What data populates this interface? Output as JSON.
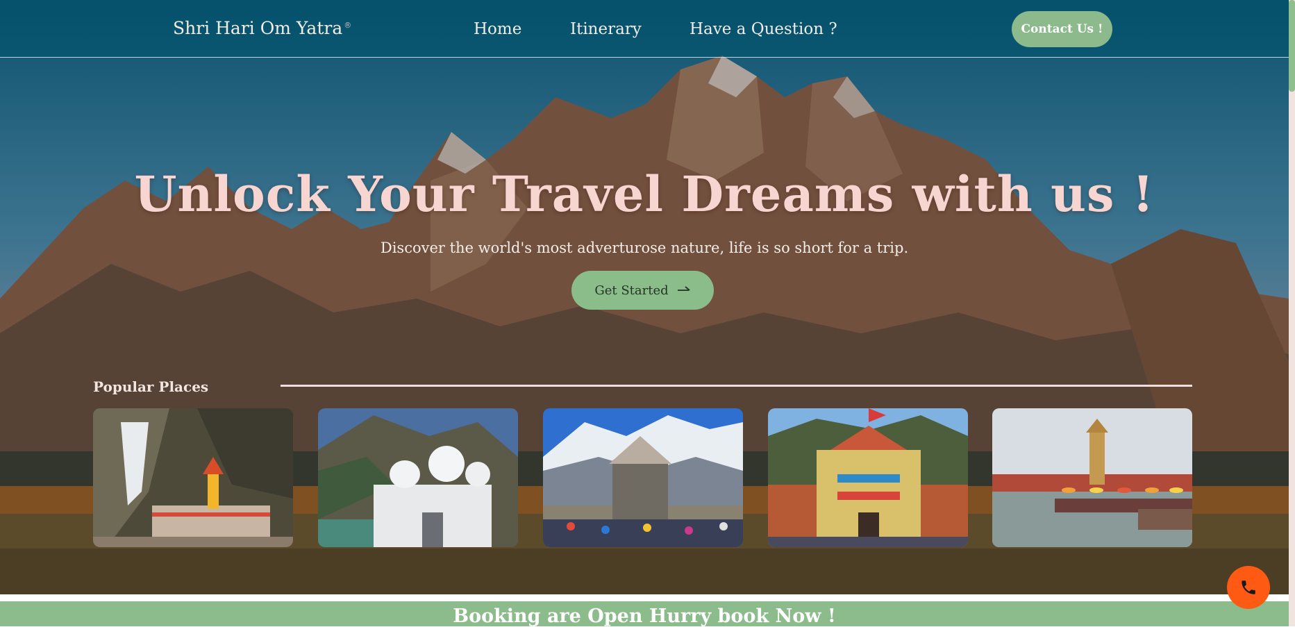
{
  "nav": {
    "brand": "Shri Hari Om Yatra",
    "brand_mark": "®",
    "links": [
      "Home",
      "Itinerary",
      "Have a Question ?"
    ],
    "contact_label": "Contact Us !"
  },
  "hero": {
    "title": "Unlock Your Travel Dreams with us !",
    "subtitle": "Discover the world's most adverturose nature, life is so short for a trip.",
    "cta_label": "Get Started",
    "cta_icon": "arrow-right-icon"
  },
  "popular": {
    "label": "Popular Places",
    "cards": [
      "yamunotri-temple",
      "gangotri-temple",
      "kedarnath-temple",
      "badrinath-temple",
      "haridwar-ghat"
    ]
  },
  "banner": {
    "text": "Booking are Open Hurry book Now !"
  },
  "floating": {
    "icon": "phone-icon"
  },
  "colors": {
    "accent_green": "#8cbb8c",
    "title_pink": "#f7d6d2",
    "phone_orange": "#ff5a14",
    "nav_teal": "#0d5f7c"
  }
}
